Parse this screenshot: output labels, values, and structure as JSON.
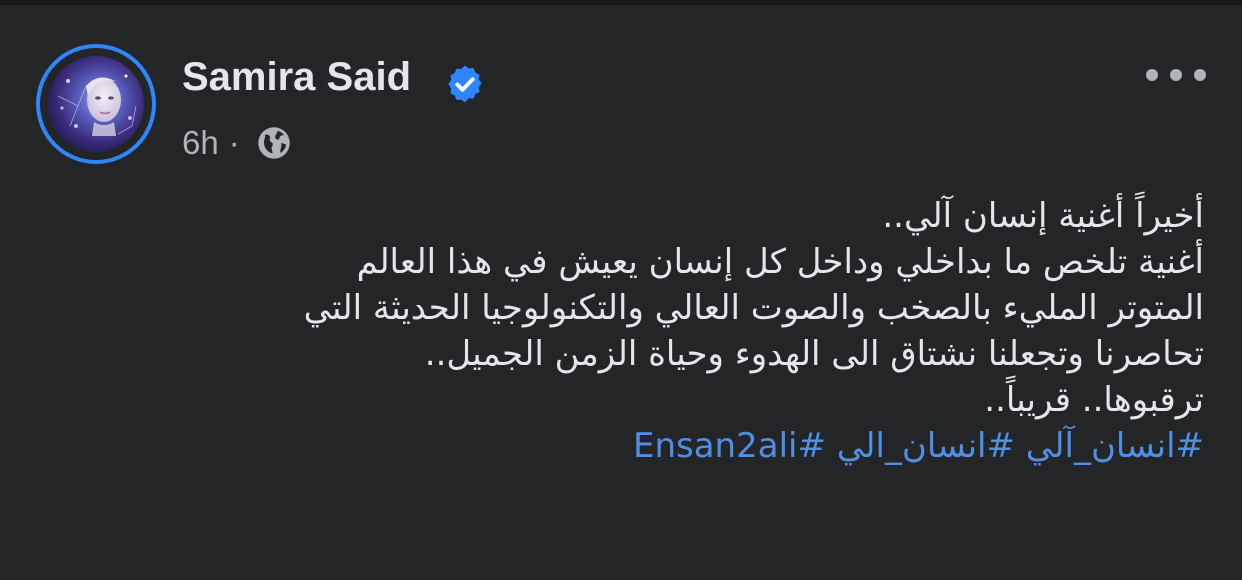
{
  "post": {
    "author": "Samira Said",
    "verified": true,
    "time": "6h",
    "separator": "·",
    "privacy_icon": "globe-icon",
    "menu_icon": "more-horizontal-icon",
    "lines": [
      "أخيراً أغنية إنسان آلي..",
      "أغنية تلخص ما بداخلي وداخل كل إنسان يعيش في هذا العالم",
      "المتوتر المليء بالصخب والصوت العالي والتكنولوجيا الحديثة التي",
      "تحاصرنا وتجعلنا نشتاق الى الهدوء وحياة الزمن الجميل..",
      "ترقبوها.. قريباً.."
    ],
    "hashtags": [
      "#انسان_آلي",
      "#انسان_الي",
      "#Ensan2ali"
    ]
  },
  "colors": {
    "background": "#242526",
    "text": "#e4e6eb",
    "secondary_text": "#b0b3b8",
    "link": "#4e8fe8",
    "verified_badge": "#2d86ff"
  }
}
